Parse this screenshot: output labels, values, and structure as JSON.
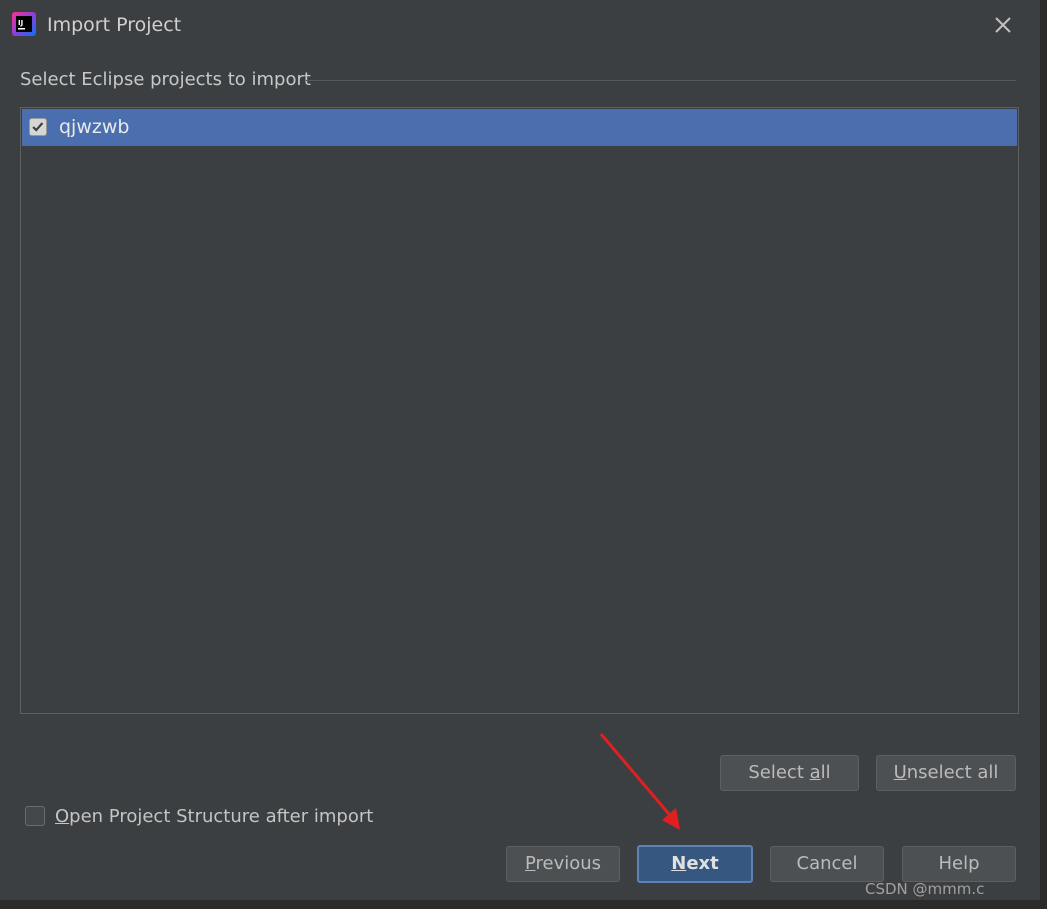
{
  "window": {
    "title": "Import Project",
    "app_icon": "intellij-idea-icon",
    "close_icon": "close-icon"
  },
  "section": {
    "title": "Select Eclipse projects to import"
  },
  "projects": [
    {
      "name": "qjwzwb",
      "checked": true,
      "selected": true
    }
  ],
  "selection_buttons": {
    "select_all": {
      "pre": "Select ",
      "mnemonic": "a",
      "post": "ll"
    },
    "unselect_all": {
      "pre": "",
      "mnemonic": "U",
      "post": "nselect all"
    }
  },
  "options": {
    "open_structure": {
      "pre": "",
      "mnemonic": "O",
      "post": "pen Project Structure after import",
      "checked": false
    }
  },
  "footer_buttons": {
    "previous": {
      "pre": "",
      "mnemonic": "P",
      "post": "revious"
    },
    "next": {
      "pre": "",
      "mnemonic": "N",
      "post": "ext"
    },
    "cancel": "Cancel",
    "help": "Help"
  },
  "watermark": "CSDN @mmm.c",
  "colors": {
    "dialog_bg": "#3c3f41",
    "selection": "#4b6eaf",
    "default_button": "#365880",
    "annotation_arrow": "#e02020"
  }
}
